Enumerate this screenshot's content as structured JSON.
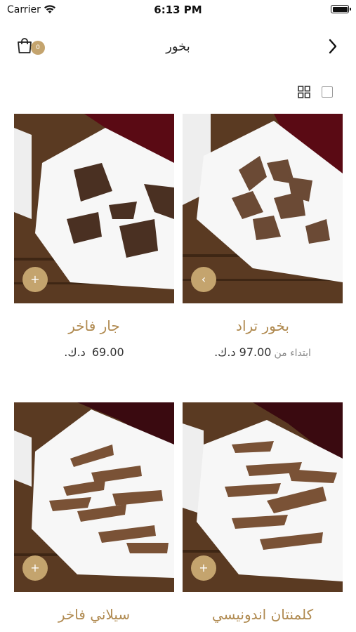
{
  "status_bar": {
    "carrier": "Carrier",
    "time": "6:13 PM"
  },
  "header": {
    "title": "بخور",
    "cart_count": "0"
  },
  "products": [
    {
      "name": "بخور تراد",
      "price_prefix": "ابتداء من",
      "price": "97.00 د.ك.",
      "action": "‹"
    },
    {
      "name": "جار فاخر",
      "price_prefix": "",
      "price": "69.00 د.ك.",
      "action": "+"
    },
    {
      "name": "كلمنتان اندونيسي",
      "price_prefix": "",
      "price": "",
      "action": "+"
    },
    {
      "name": "سيلاني فاخر",
      "price_prefix": "",
      "price": "",
      "action": "+"
    }
  ],
  "icons": {
    "cart": "shopping-bag-icon",
    "back": "chevron-right-icon",
    "grid": "grid-view-icon",
    "list": "list-view-icon",
    "wifi": "wifi-icon",
    "battery": "battery-icon"
  },
  "colors": {
    "accent": "#c4a46e",
    "title_gold": "#b08a50",
    "wood": "#5a3a22",
    "cloth": "#f7f7f7",
    "dark_red": "#5a0a14"
  }
}
